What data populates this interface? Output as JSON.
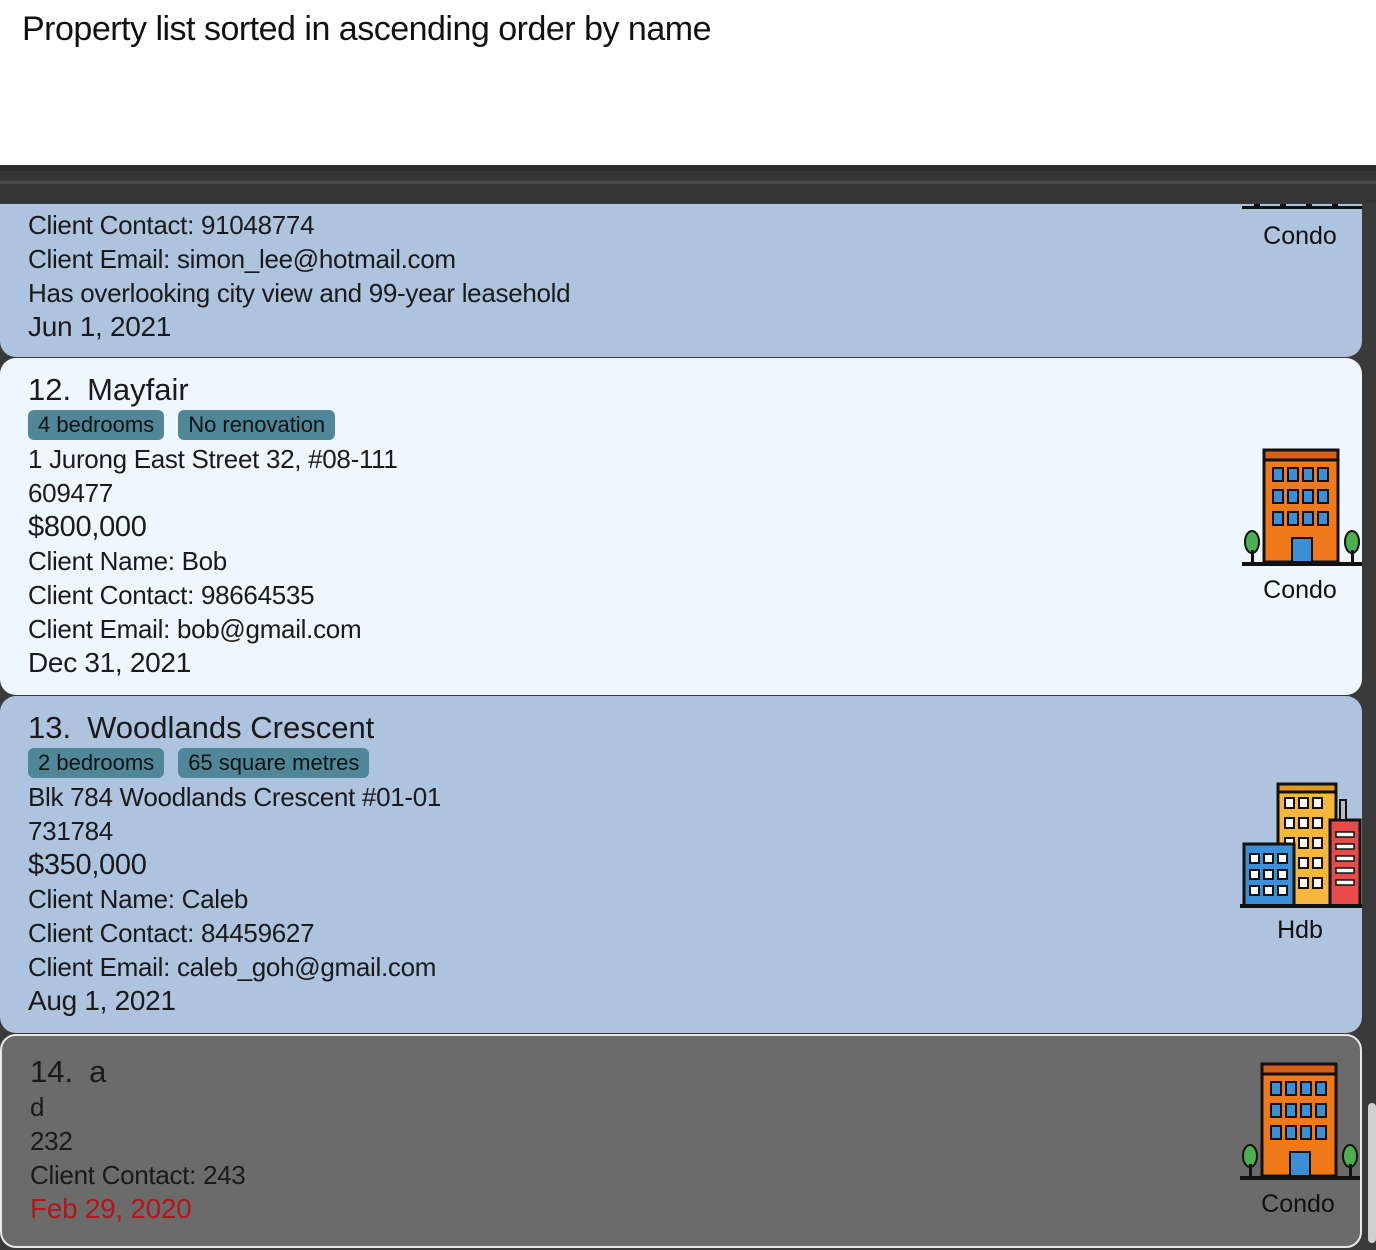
{
  "result_message": "Property list sorted in ascending order by name",
  "colors": {
    "card_odd": "#aec3de",
    "card_even": "#eef6fe",
    "card_selected": "#6b6b6b",
    "tag": "#4f8799",
    "overdue_date": "#b3161a"
  },
  "properties": [
    {
      "contact": "Client Contact: 91048774",
      "email": "Client Email: simon_lee@hotmail.com",
      "remark": "Has overlooking city view and 99-year leasehold",
      "date": "Jun 1, 2021",
      "type": "Condo",
      "icon": "condo-building-icon"
    },
    {
      "index": "12.",
      "name": "Mayfair",
      "tags": [
        "4 bedrooms",
        "No renovation"
      ],
      "address": "1 Jurong East Street 32, #08-111",
      "postal": "609477",
      "price": "$800,000",
      "client_name": "Client Name: Bob",
      "contact": "Client Contact: 98664535",
      "email": "Client Email: bob@gmail.com",
      "date": "Dec 31, 2021",
      "type": "Condo",
      "icon": "condo-building-icon"
    },
    {
      "index": "13.",
      "name": "Woodlands Crescent",
      "tags": [
        "2 bedrooms",
        "65 square metres"
      ],
      "address": "Blk 784 Woodlands Crescent #01-01",
      "postal": "731784",
      "price": "$350,000",
      "client_name": "Client Name: Caleb",
      "contact": "Client Contact: 84459627",
      "email": "Client Email: caleb_goh@gmail.com",
      "date": "Aug 1, 2021",
      "type": "Hdb",
      "icon": "hdb-buildings-icon"
    },
    {
      "index": "14.",
      "name": "a",
      "address": "d",
      "postal": "232",
      "contact": "Client Contact: 243",
      "date": "Feb 29, 2020",
      "date_overdue": true,
      "type": "Condo",
      "icon": "condo-building-icon"
    }
  ]
}
